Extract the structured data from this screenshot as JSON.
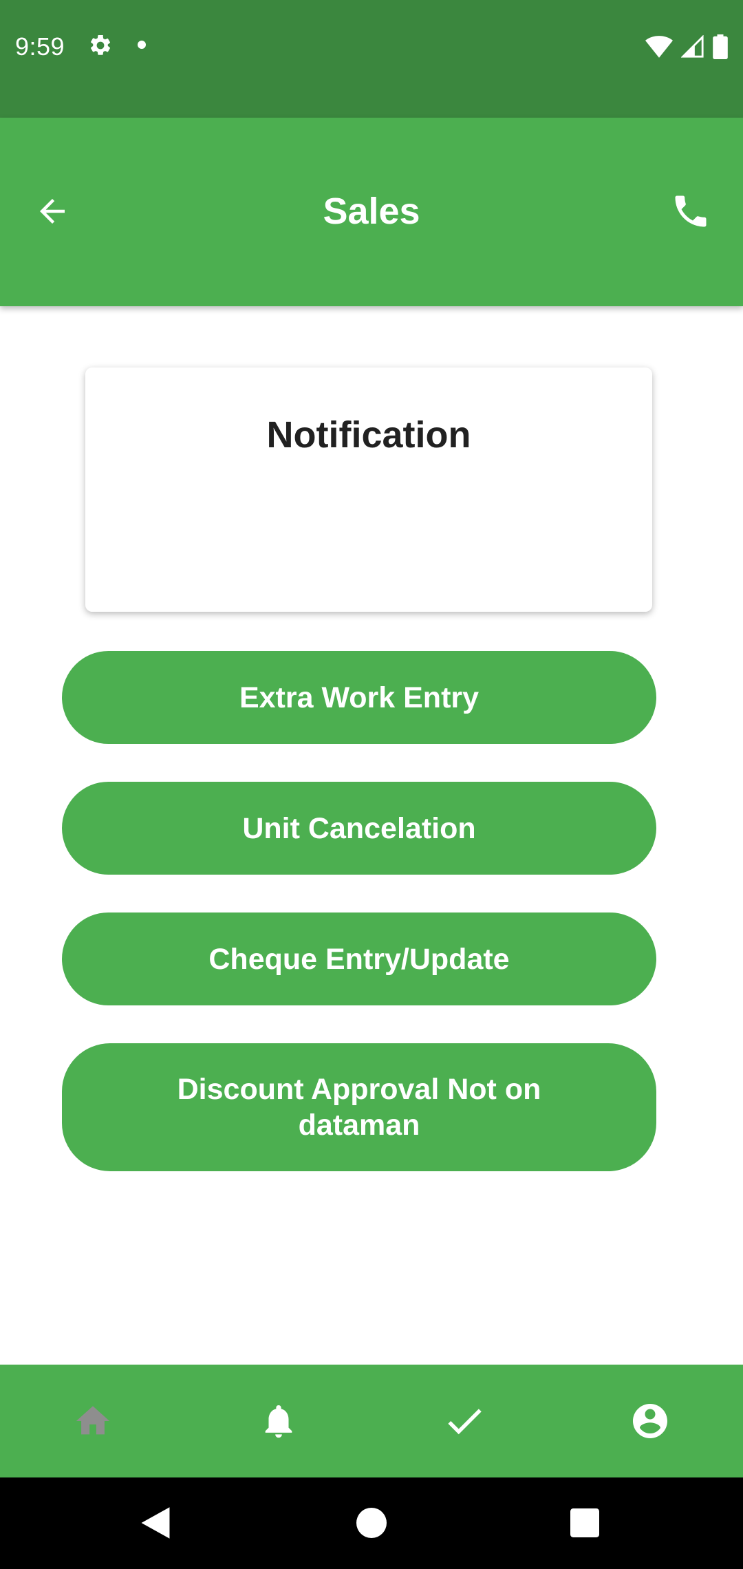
{
  "status_bar": {
    "time": "9:59",
    "icons": [
      "gear-icon",
      "notification-dot-icon",
      "wifi-icon",
      "cell-signal-icon",
      "battery-icon"
    ]
  },
  "app_bar": {
    "title": "Sales",
    "back_icon": "arrow-back-icon",
    "call_icon": "phone-icon"
  },
  "notification_card": {
    "title": "Notification"
  },
  "actions": [
    {
      "label": "Extra Work Entry"
    },
    {
      "label": "Unit Cancelation"
    },
    {
      "label": "Cheque Entry/Update"
    },
    {
      "label": "Discount Approval Not on dataman"
    }
  ],
  "bottom_nav": {
    "items": [
      {
        "icon": "home-icon",
        "state": "disabled"
      },
      {
        "icon": "bell-icon",
        "state": "active"
      },
      {
        "icon": "check-icon",
        "state": "active"
      },
      {
        "icon": "account-circle-icon",
        "state": "active"
      }
    ]
  },
  "colors": {
    "status_bar": "#3b873e",
    "primary": "#4caf50",
    "on_primary": "#ffffff",
    "nav_disabled": "#8e8e8e",
    "text_dark": "#212121"
  }
}
